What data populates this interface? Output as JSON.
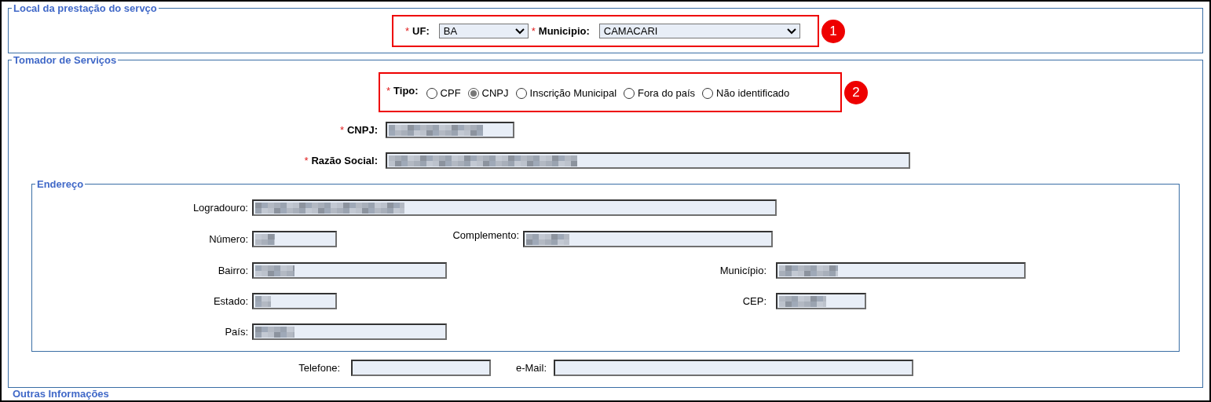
{
  "local": {
    "legend": "Local da prestação do servço",
    "callout": "1",
    "uf": {
      "asterisk": "*",
      "label": "UF:",
      "value": "BA"
    },
    "municipio": {
      "asterisk": "*",
      "label": "Municipio:",
      "value": "CAMACARI"
    }
  },
  "tomador": {
    "legend": "Tomador de Serviços",
    "callout": "2",
    "tipo": {
      "asterisk": "*",
      "label": "Tipo:",
      "options": [
        {
          "label": "CPF",
          "selected": false
        },
        {
          "label": "CNPJ",
          "selected": true
        },
        {
          "label": "Inscrição Municipal",
          "selected": false
        },
        {
          "label": "Fora do país",
          "selected": false
        },
        {
          "label": "Não identificado",
          "selected": false
        }
      ]
    },
    "cnpj": {
      "asterisk": "*",
      "label": "CNPJ:",
      "redacted": true
    },
    "razao_social": {
      "asterisk": "*",
      "label": "Razão Social:",
      "redacted": true
    },
    "endereco": {
      "legend": "Endereço",
      "fields": [
        {
          "label": "Logradouro:",
          "redacted": true
        },
        {
          "label": "Número:",
          "redacted": true
        },
        {
          "label": "Complemento:",
          "redacted": true
        },
        {
          "label": "Bairro:",
          "redacted": true
        },
        {
          "label": "Município:",
          "redacted": true
        },
        {
          "label": "Estado:",
          "redacted": true
        },
        {
          "label": "CEP:",
          "redacted": true
        },
        {
          "label": "País:",
          "redacted": true
        }
      ]
    },
    "telefone": {
      "label": "Telefone:",
      "redacted": false
    },
    "email": {
      "label": "e-Mail:",
      "redacted": false
    }
  },
  "next_section": {
    "legend": "Outras Informações"
  }
}
